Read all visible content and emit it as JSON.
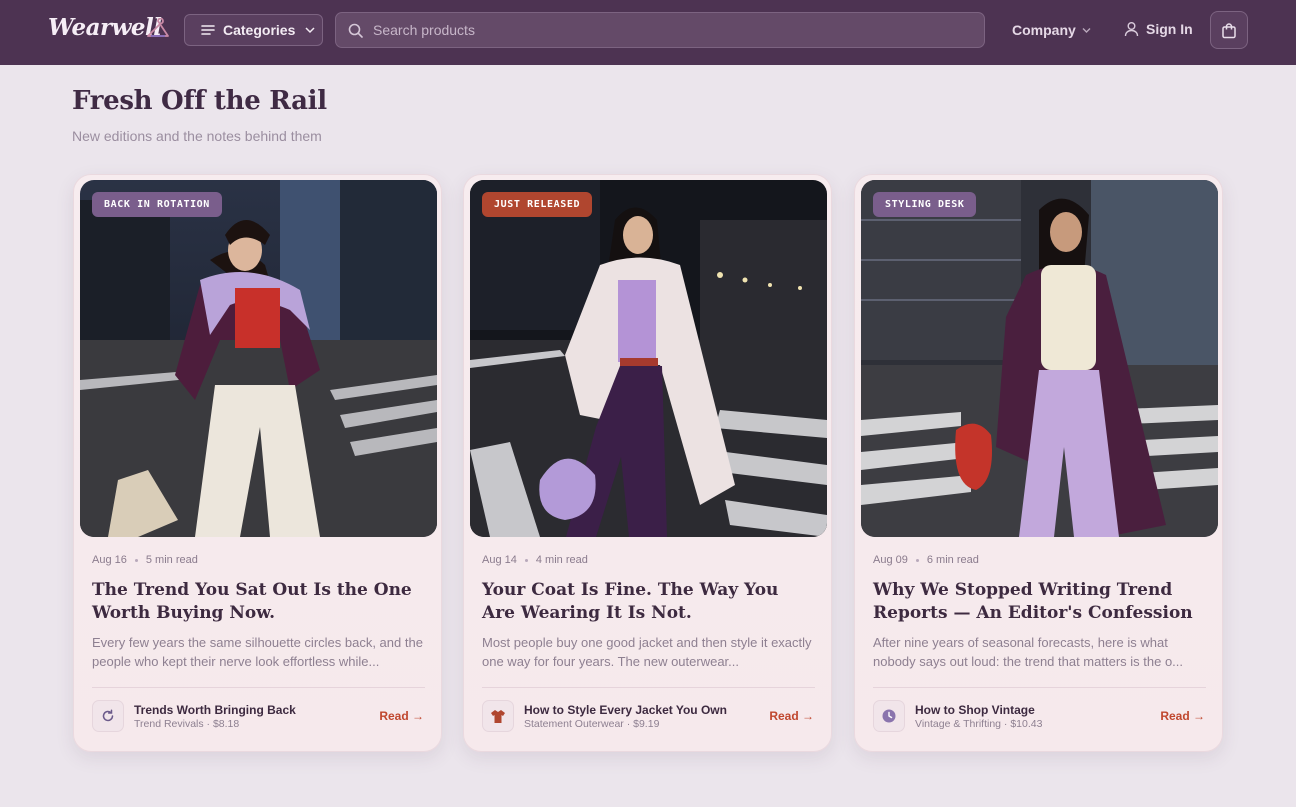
{
  "header": {
    "logo": "Wearwell",
    "categories_label": "Categories",
    "search_placeholder": "Search products",
    "company_label": "Company",
    "signin_label": "Sign In"
  },
  "section": {
    "title": "Fresh Off the Rail",
    "subtitle": "New editions and the notes behind them"
  },
  "colors": {
    "header_bg": "#4d3352",
    "page_bg": "#ebe5ec",
    "accent_read": "#c0472e",
    "badge_purple": "#7a5e8c",
    "badge_red": "#b0462f"
  },
  "cards": [
    {
      "badge": "BACK IN ROTATION",
      "date": "Aug 16",
      "read_time": "5 min read",
      "title": "The Trend You Sat Out Is the One Worth Buying Now.",
      "excerpt": "Every few years the same silhouette circles back, and the people who kept their nerve look effortless while...",
      "product_name": "Trends Worth Bringing Back",
      "product_meta": "Trend Revivals · $8.18",
      "product_icon": "refresh-icon",
      "read_label": "Read →"
    },
    {
      "badge": "JUST RELEASED",
      "date": "Aug 14",
      "read_time": "4 min read",
      "title": "Your Coat Is Fine. The Way You Are Wearing It Is Not.",
      "excerpt": "Most people buy one good jacket and then style it exactly one way for four years. The new outerwear...",
      "product_name": "How to Style Every Jacket You Own",
      "product_meta": "Statement Outerwear · $9.19",
      "product_icon": "jacket-icon",
      "read_label": "Read →"
    },
    {
      "badge": "STYLING DESK",
      "date": "Aug 09",
      "read_time": "6 min read",
      "title": "Why We Stopped Writing Trend Reports — An Editor's Confession",
      "excerpt": "After nine years of seasonal forecasts, here is what nobody says out loud: the trend that matters is the o...",
      "product_name": "How to Shop Vintage",
      "product_meta": "Vintage & Thrifting · $10.43",
      "product_icon": "clock-icon",
      "read_label": "Read →"
    }
  ]
}
